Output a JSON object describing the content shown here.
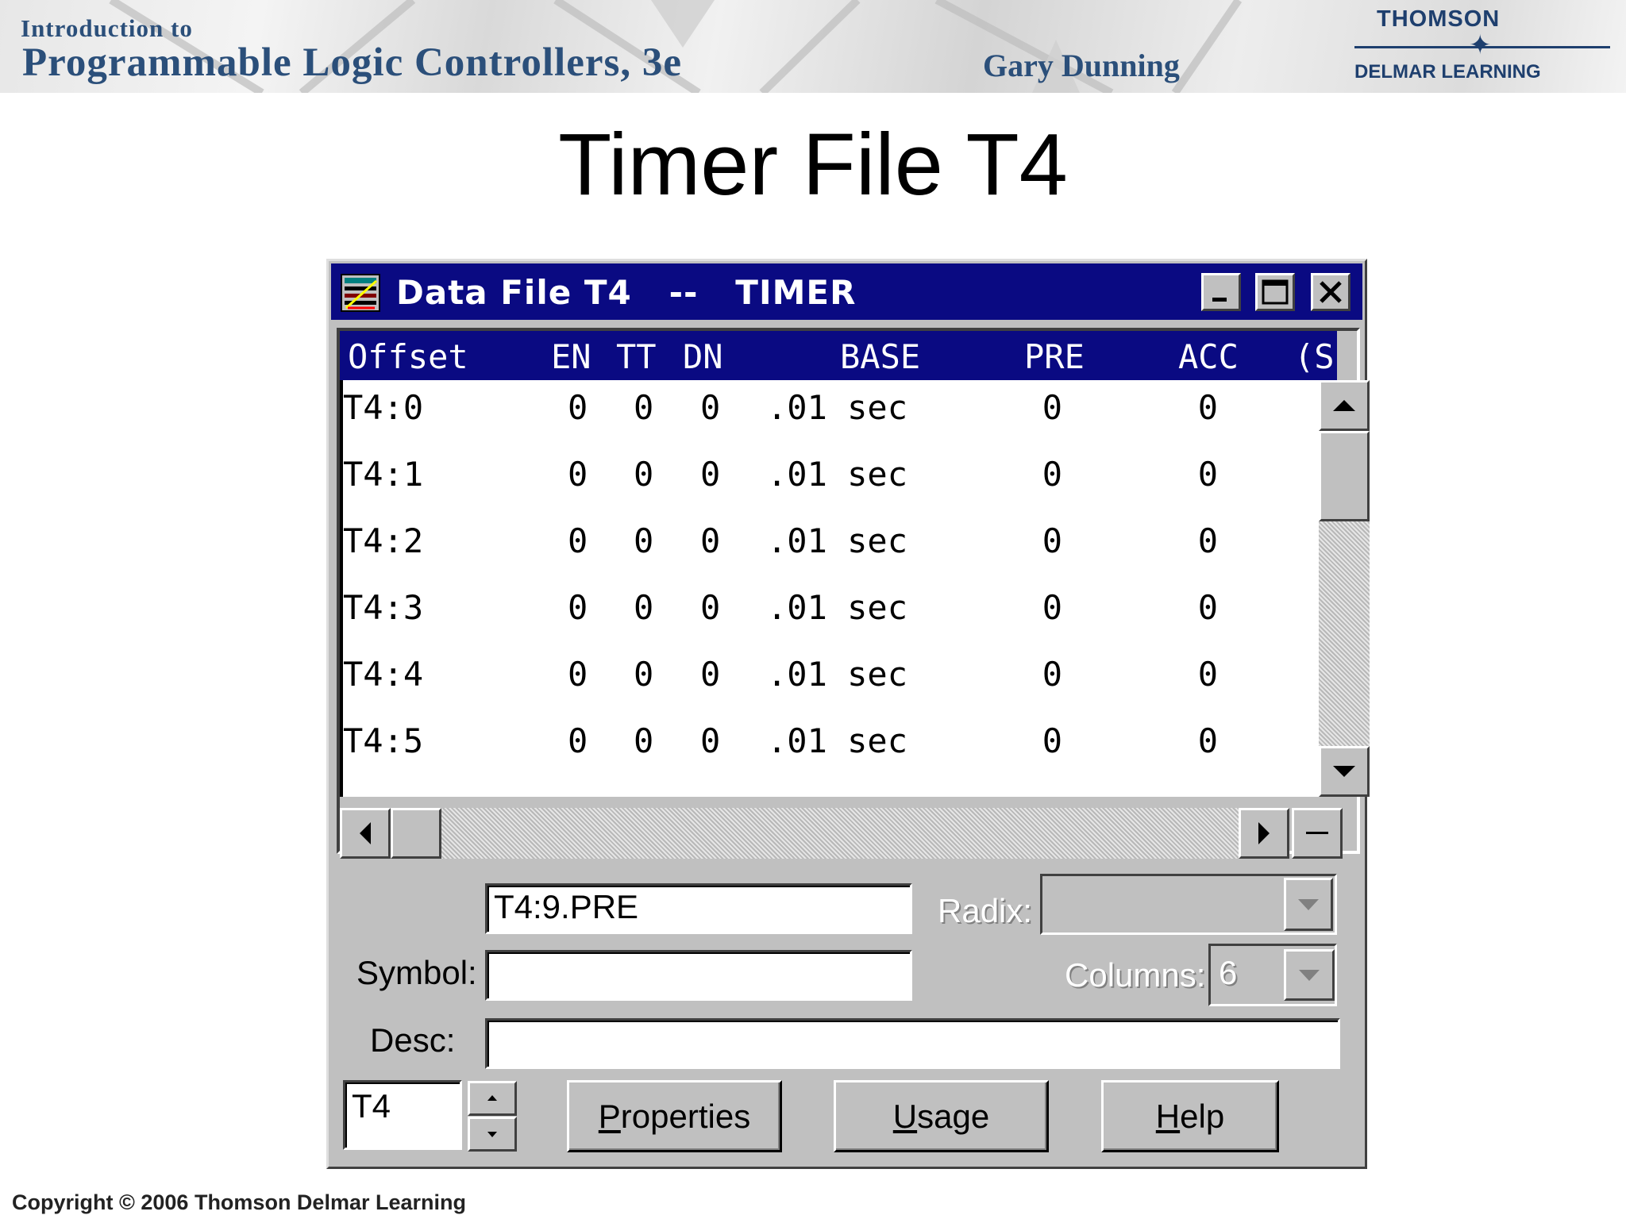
{
  "banner": {
    "subtitle": "Introduction to",
    "book_title": "Programmable Logic Controllers, 3e",
    "author": "Gary Dunning",
    "publisher_line1": "THOMSON",
    "publisher_line2": "DELMAR LEARNING"
  },
  "slide": {
    "title": "Timer File T4"
  },
  "window": {
    "title": "Data File T4   --   TIMER",
    "icon": "data-file-icon",
    "controls": {
      "minimize": "minimize-icon",
      "maximize": "maximize-icon",
      "close": "close-icon"
    }
  },
  "table": {
    "columns": [
      "Offset",
      "EN",
      "TT",
      "DN",
      "BASE",
      "PRE",
      "ACC",
      "(S"
    ],
    "rows": [
      {
        "offset": "T4:0",
        "en": "0",
        "tt": "0",
        "dn": "0",
        "base": ".01 sec",
        "pre": "0",
        "acc": "0"
      },
      {
        "offset": "T4:1",
        "en": "0",
        "tt": "0",
        "dn": "0",
        "base": ".01 sec",
        "pre": "0",
        "acc": "0"
      },
      {
        "offset": "T4:2",
        "en": "0",
        "tt": "0",
        "dn": "0",
        "base": ".01 sec",
        "pre": "0",
        "acc": "0"
      },
      {
        "offset": "T4:3",
        "en": "0",
        "tt": "0",
        "dn": "0",
        "base": ".01 sec",
        "pre": "0",
        "acc": "0"
      },
      {
        "offset": "T4:4",
        "en": "0",
        "tt": "0",
        "dn": "0",
        "base": ".01 sec",
        "pre": "0",
        "acc": "0"
      },
      {
        "offset": "T4:5",
        "en": "0",
        "tt": "0",
        "dn": "0",
        "base": ".01 sec",
        "pre": "0",
        "acc": "0"
      }
    ]
  },
  "form": {
    "address_value": "T4:9.PRE",
    "radix_label": "Radix:",
    "radix_value": "",
    "symbol_label": "Symbol:",
    "symbol_value": "",
    "columns_label": "Columns:",
    "columns_value": "6",
    "desc_label": "Desc:",
    "desc_value": "",
    "file_value": "T4",
    "properties_button": {
      "accel": "P",
      "rest": "roperties"
    },
    "usage_button": {
      "accel": "U",
      "rest": "sage"
    },
    "help_button": {
      "accel": "H",
      "rest": "elp"
    }
  },
  "footer": {
    "copyright": "Copyright © 2006 Thomson Delmar Learning"
  }
}
